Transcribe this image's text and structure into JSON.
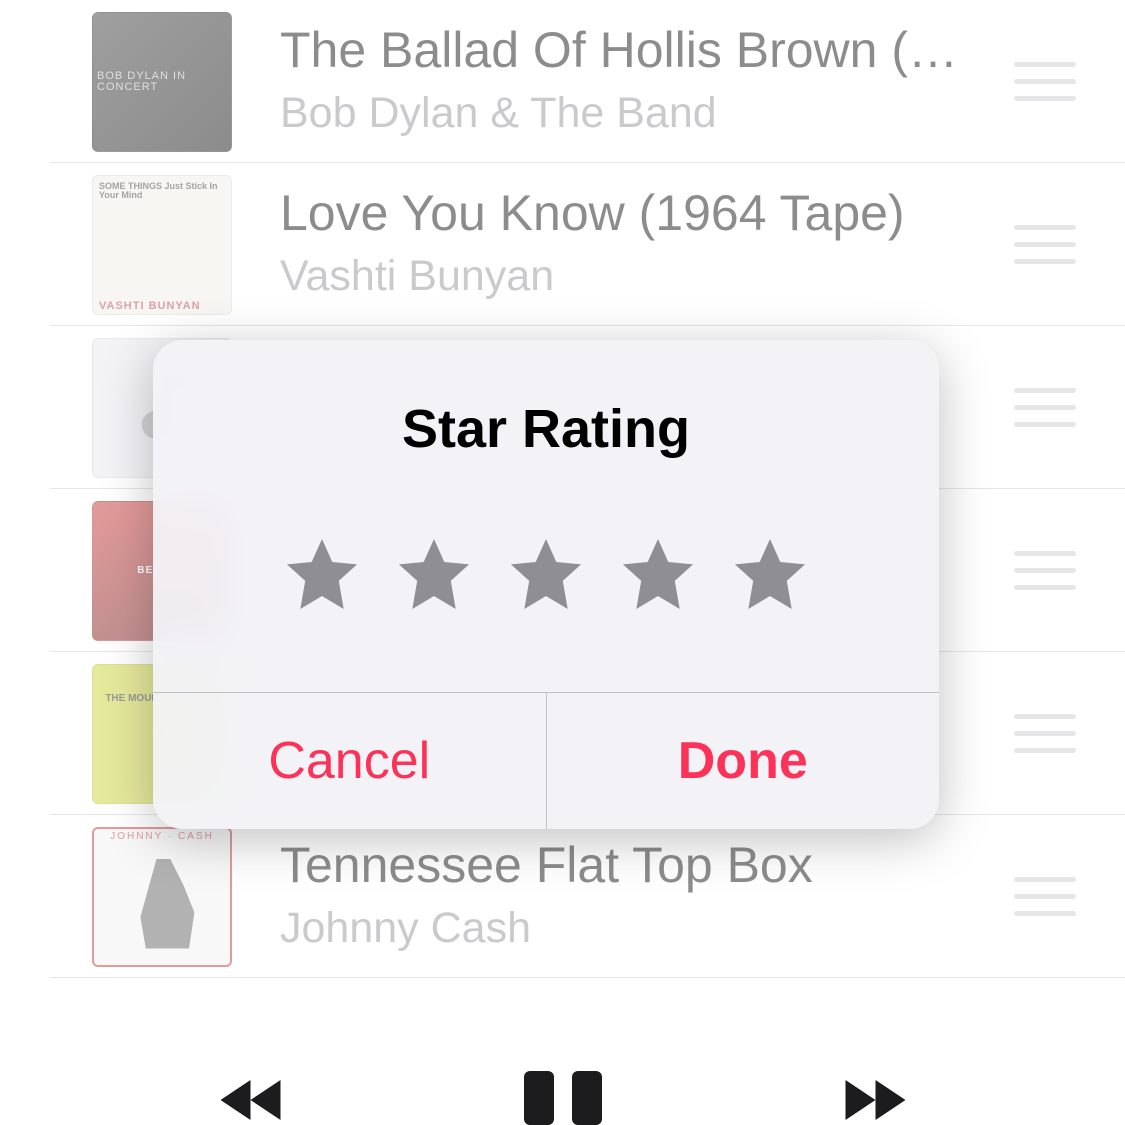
{
  "songs": [
    {
      "title": "The Ballad Of Hollis Brown (L…",
      "artist": "Bob Dylan & The Band",
      "art": "art-dylan"
    },
    {
      "title": "Love You Know (1964 Tape)",
      "artist": "Vashti Bunyan",
      "art": "art-vashti"
    },
    {
      "title": "",
      "artist": "",
      "art": "art-placeholder"
    },
    {
      "title": "",
      "artist": "",
      "art": "art-red"
    },
    {
      "title": "",
      "artist": "",
      "art": "art-green"
    },
    {
      "title": "Tennessee Flat Top Box",
      "artist": "Johnny Cash",
      "art": "art-cash"
    }
  ],
  "modal": {
    "title": "Star Rating",
    "star_count": 5,
    "cancel": "Cancel",
    "done": "Done"
  },
  "colors": {
    "accent": "#fc3258"
  }
}
